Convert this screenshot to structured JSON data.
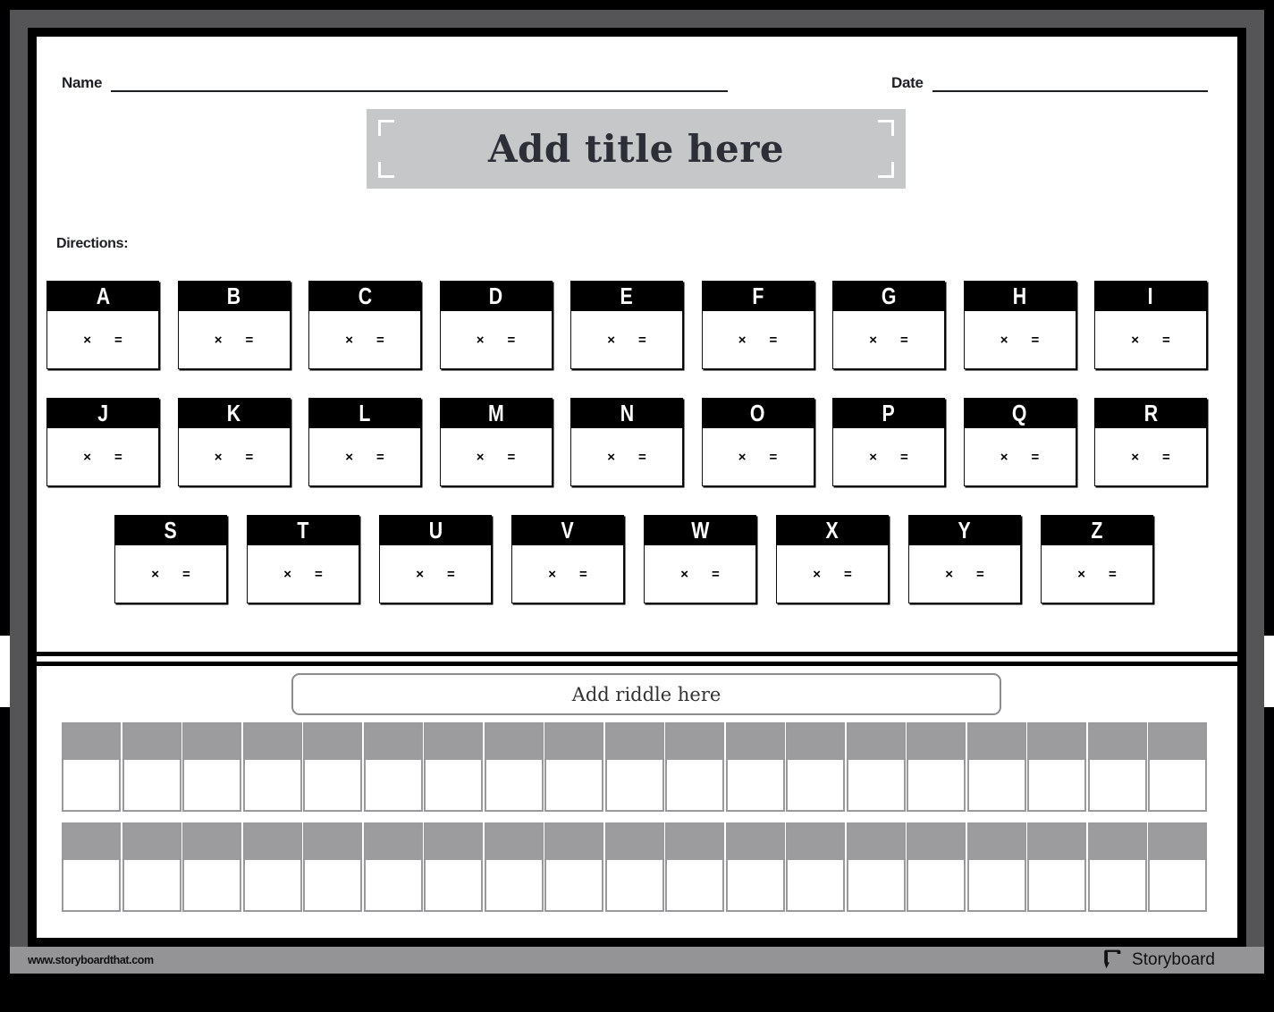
{
  "header": {
    "name_label": "Name",
    "date_label": "Date",
    "name_value": "",
    "date_value": ""
  },
  "title": {
    "placeholder": "Add title here",
    "corner_icon": "crop-corner-icon"
  },
  "directions": {
    "label": "Directions:",
    "text": ""
  },
  "cipher": {
    "multiply_symbol": "×",
    "equals_symbol": "=",
    "rows": [
      {
        "cards": [
          {
            "letter": "A",
            "factor": "",
            "product": ""
          },
          {
            "letter": "B",
            "factor": "",
            "product": ""
          },
          {
            "letter": "C",
            "factor": "",
            "product": ""
          },
          {
            "letter": "D",
            "factor": "",
            "product": ""
          },
          {
            "letter": "E",
            "factor": "",
            "product": ""
          },
          {
            "letter": "F",
            "factor": "",
            "product": ""
          },
          {
            "letter": "G",
            "factor": "",
            "product": ""
          },
          {
            "letter": "H",
            "factor": "",
            "product": ""
          },
          {
            "letter": "I",
            "factor": "",
            "product": ""
          }
        ]
      },
      {
        "cards": [
          {
            "letter": "J",
            "factor": "",
            "product": ""
          },
          {
            "letter": "K",
            "factor": "",
            "product": ""
          },
          {
            "letter": "L",
            "factor": "",
            "product": ""
          },
          {
            "letter": "M",
            "factor": "",
            "product": ""
          },
          {
            "letter": "N",
            "factor": "",
            "product": ""
          },
          {
            "letter": "O",
            "factor": "",
            "product": ""
          },
          {
            "letter": "P",
            "factor": "",
            "product": ""
          },
          {
            "letter": "Q",
            "factor": "",
            "product": ""
          },
          {
            "letter": "R",
            "factor": "",
            "product": ""
          }
        ]
      },
      {
        "cards": [
          {
            "letter": "S",
            "factor": "",
            "product": ""
          },
          {
            "letter": "T",
            "factor": "",
            "product": ""
          },
          {
            "letter": "U",
            "factor": "",
            "product": ""
          },
          {
            "letter": "V",
            "factor": "",
            "product": ""
          },
          {
            "letter": "W",
            "factor": "",
            "product": ""
          },
          {
            "letter": "X",
            "factor": "",
            "product": ""
          },
          {
            "letter": "Y",
            "factor": "",
            "product": ""
          },
          {
            "letter": "Z",
            "factor": "",
            "product": ""
          }
        ]
      }
    ]
  },
  "riddle": {
    "placeholder": "Add riddle here"
  },
  "answer_grid": {
    "rows": [
      {
        "cells": [
          "",
          "",
          "",
          "",
          "",
          "",
          "",
          "",
          "",
          "",
          "",
          "",
          "",
          "",
          "",
          "",
          "",
          "",
          ""
        ]
      },
      {
        "cells": [
          "",
          "",
          "",
          "",
          "",
          "",
          "",
          "",
          "",
          "",
          "",
          "",
          "",
          "",
          "",
          "",
          "",
          "",
          ""
        ]
      }
    ]
  },
  "footer": {
    "url": "www.storyboardthat.com",
    "brand": "Storyboard",
    "brand_icon": "speech-bubble-icon"
  },
  "colors": {
    "frame_outer": "#555558",
    "frame_inner": "#000000",
    "title_bg": "#c6c7c9",
    "grid_cell_top": "#9c9c9e",
    "grid_cell_border": "#9a9a9c",
    "footer_bg": "#949496",
    "card_header": "#000000",
    "ink": "#1d1f24"
  }
}
